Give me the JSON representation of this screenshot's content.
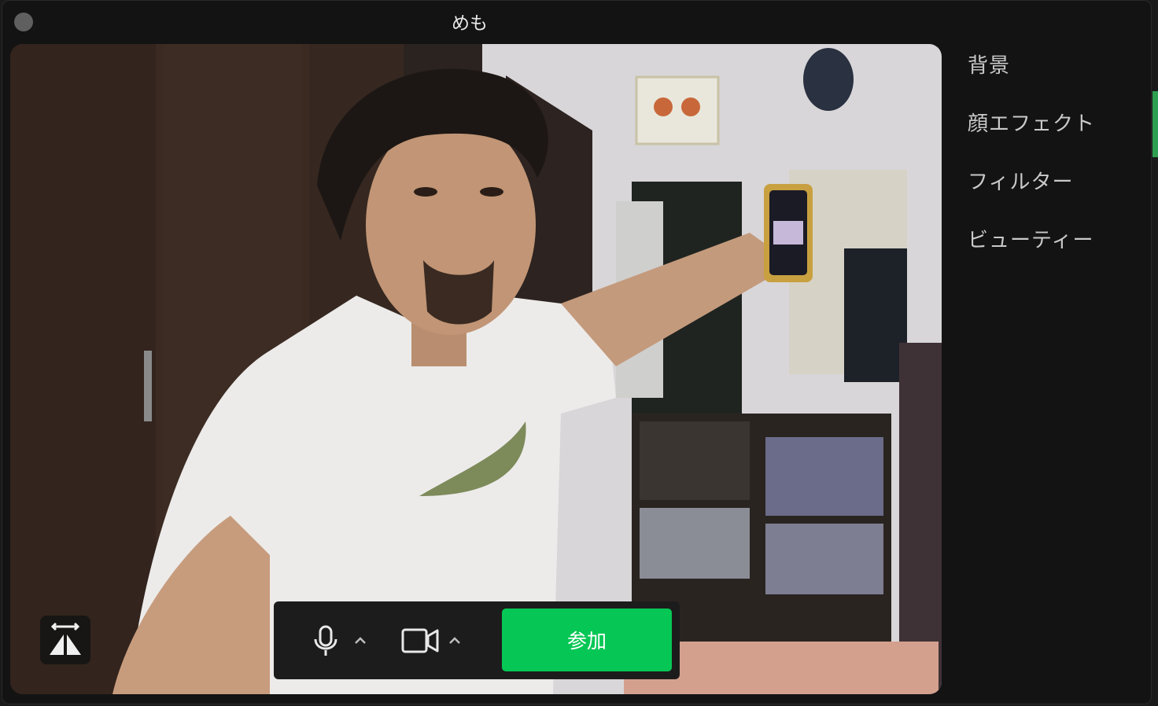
{
  "window": {
    "title": "めも"
  },
  "controls": {
    "join_label": "参加",
    "mic_icon": "microphone-icon",
    "camera_icon": "video-camera-icon",
    "join_color": "#06c755"
  },
  "side_panel": {
    "items": [
      {
        "label": "背景"
      },
      {
        "label": "顔エフェクト"
      },
      {
        "label": "フィルター"
      },
      {
        "label": "ビューティー"
      }
    ]
  },
  "mirror_button": {
    "icon": "mirror-flip-icon"
  }
}
